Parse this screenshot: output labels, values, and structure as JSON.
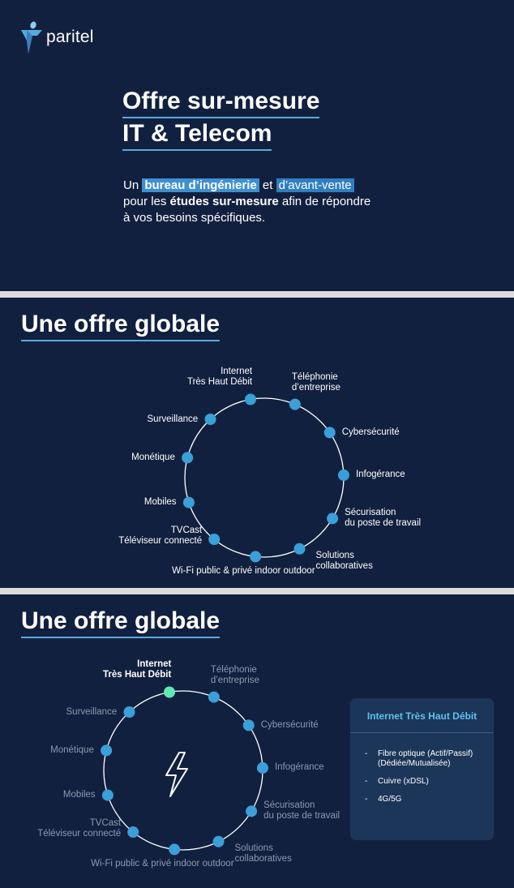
{
  "brand": {
    "name": "paritel"
  },
  "hero": {
    "title_line1": "Offre sur-mesure",
    "title_line2": "IT & Telecom",
    "text": {
      "p1": "Un ",
      "hl1": "bureau d’ingénierie",
      "p2": " et ",
      "hl2": "d’avant-vente",
      "p3": "pour les ",
      "bold": "études sur-mesure",
      "p4": " afin de répondre",
      "p5": "à vos besoins spécifiques."
    }
  },
  "section2": {
    "title": "Une offre globale",
    "items": [
      "Internet\nTrès Haut Débit",
      "Téléphonie\nd’entreprise",
      "Cybersécurité",
      "Infogérance",
      "Sécurisation\ndu poste de travail",
      "Solutions\ncollaboratives",
      "Wi-Fi public & privé indoor outdoor",
      "TVCast\nTéléviseur connecté",
      "Mobiles",
      "Monétique",
      "Surveillance"
    ]
  },
  "section3": {
    "title": "Une offre globale",
    "active_index": 0,
    "center_icon": "lightning-icon",
    "card": {
      "title": "Internet Très Haut Débit",
      "items": [
        "Fibre optique (Actif/Passif)\n(Dédiée/Mutualisée)",
        "Cuivre (xDSL)",
        "4G/5G"
      ]
    }
  },
  "colors": {
    "background": "#12203f",
    "accent": "#5aa9dc",
    "node": "#3b9fd8",
    "active_node": "#5ee8b8",
    "card": "#1c3659",
    "card_title": "#5ec2ee"
  }
}
